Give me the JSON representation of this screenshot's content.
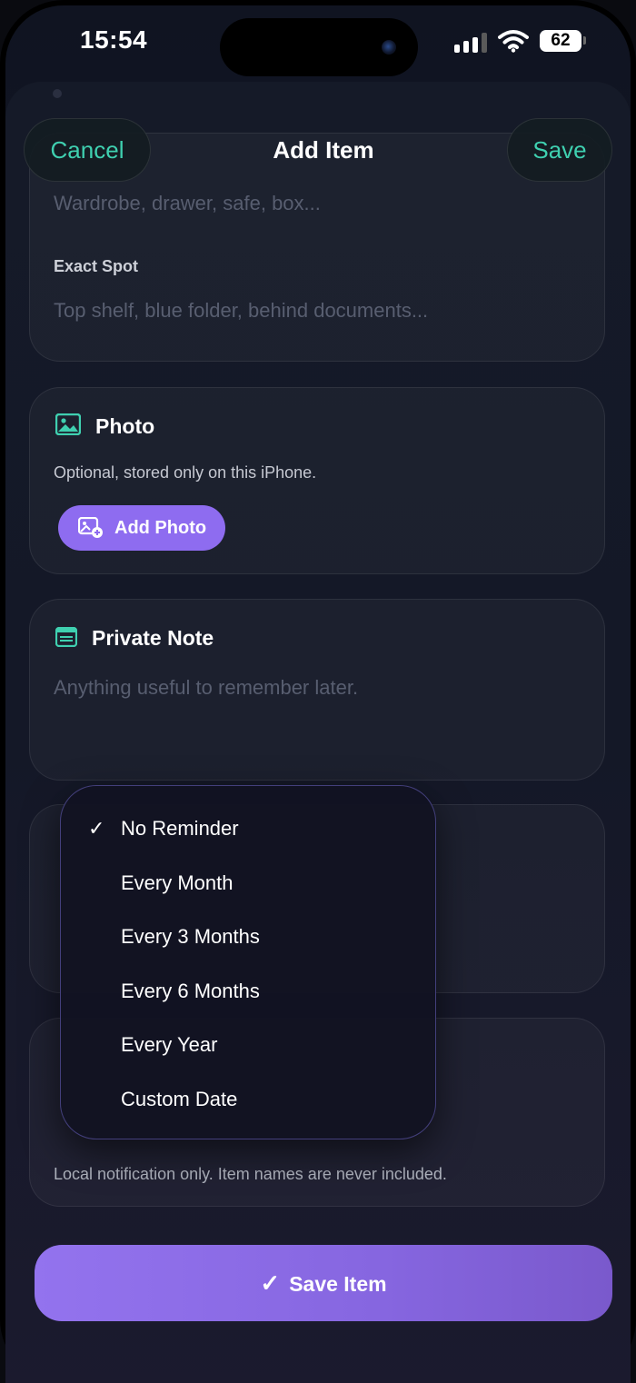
{
  "status_bar": {
    "time": "15:54",
    "battery": "62"
  },
  "nav": {
    "cancel_label": "Cancel",
    "title": "Add Item",
    "save_label": "Save"
  },
  "location": {
    "container_placeholder": "Wardrobe, drawer, safe, box...",
    "exact_spot_label": "Exact Spot",
    "exact_spot_placeholder": "Top shelf, blue folder, behind documents..."
  },
  "photo": {
    "title": "Photo",
    "helper": "Optional, stored only on this iPhone.",
    "add_label": "Add Photo",
    "icon": "image-icon"
  },
  "note": {
    "title": "Private Note",
    "placeholder": "Anything useful to remember later.",
    "icon": "note-icon"
  },
  "reminder": {
    "helper": "Local notification only. Item names are never included.",
    "options": [
      "No Reminder",
      "Every Month",
      "Every 3 Months",
      "Every 6 Months",
      "Every Year",
      "Custom Date"
    ],
    "selected": "No Reminder"
  },
  "save_item_label": "Save Item",
  "colors": {
    "accent_teal": "#3fd0b0",
    "accent_purple": "#8e6cf0"
  }
}
